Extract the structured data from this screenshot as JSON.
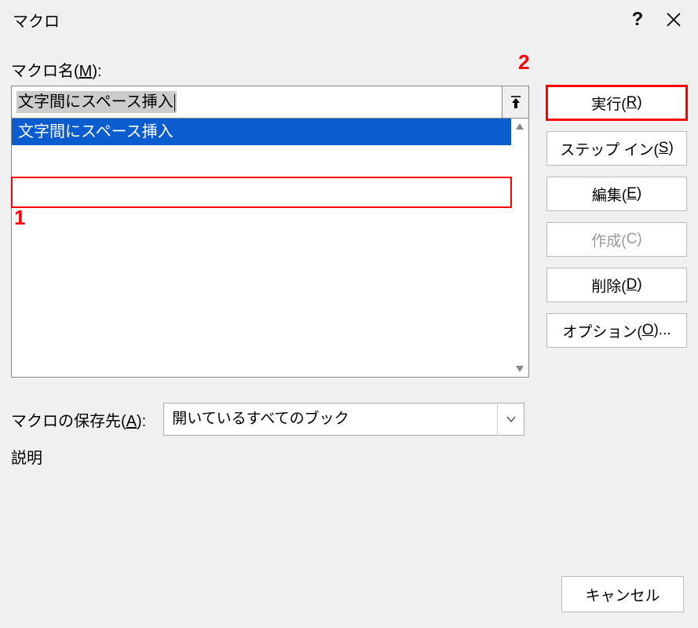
{
  "title": "マクロ",
  "titlebar": {
    "help_tooltip": "?",
    "close_icon": "close-icon"
  },
  "macro_name": {
    "label_pre": "マクロ名(",
    "label_key": "M",
    "label_post": "):",
    "value": "文字間にスペース挿入"
  },
  "list": {
    "items": [
      "文字間にスペース挿入"
    ]
  },
  "annotations": {
    "a1": "1",
    "a2": "2"
  },
  "buttons": {
    "run_pre": "実行(",
    "run_key": "R",
    "run_post": ")",
    "stepin_pre": "ステップ イン(",
    "stepin_key": "S",
    "stepin_post": ")",
    "edit_pre": "編集(",
    "edit_key": "E",
    "edit_post": ")",
    "create_pre": "作成(",
    "create_key": "C",
    "create_post": ")",
    "delete_pre": "削除(",
    "delete_key": "D",
    "delete_post": ")",
    "options_pre": "オプション(",
    "options_key": "O",
    "options_post": ")...",
    "cancel": "キャンセル"
  },
  "storage": {
    "label_pre": "マクロの保存先(",
    "label_key": "A",
    "label_post": "):",
    "selected": "開いているすべてのブック"
  },
  "description_label": "説明"
}
